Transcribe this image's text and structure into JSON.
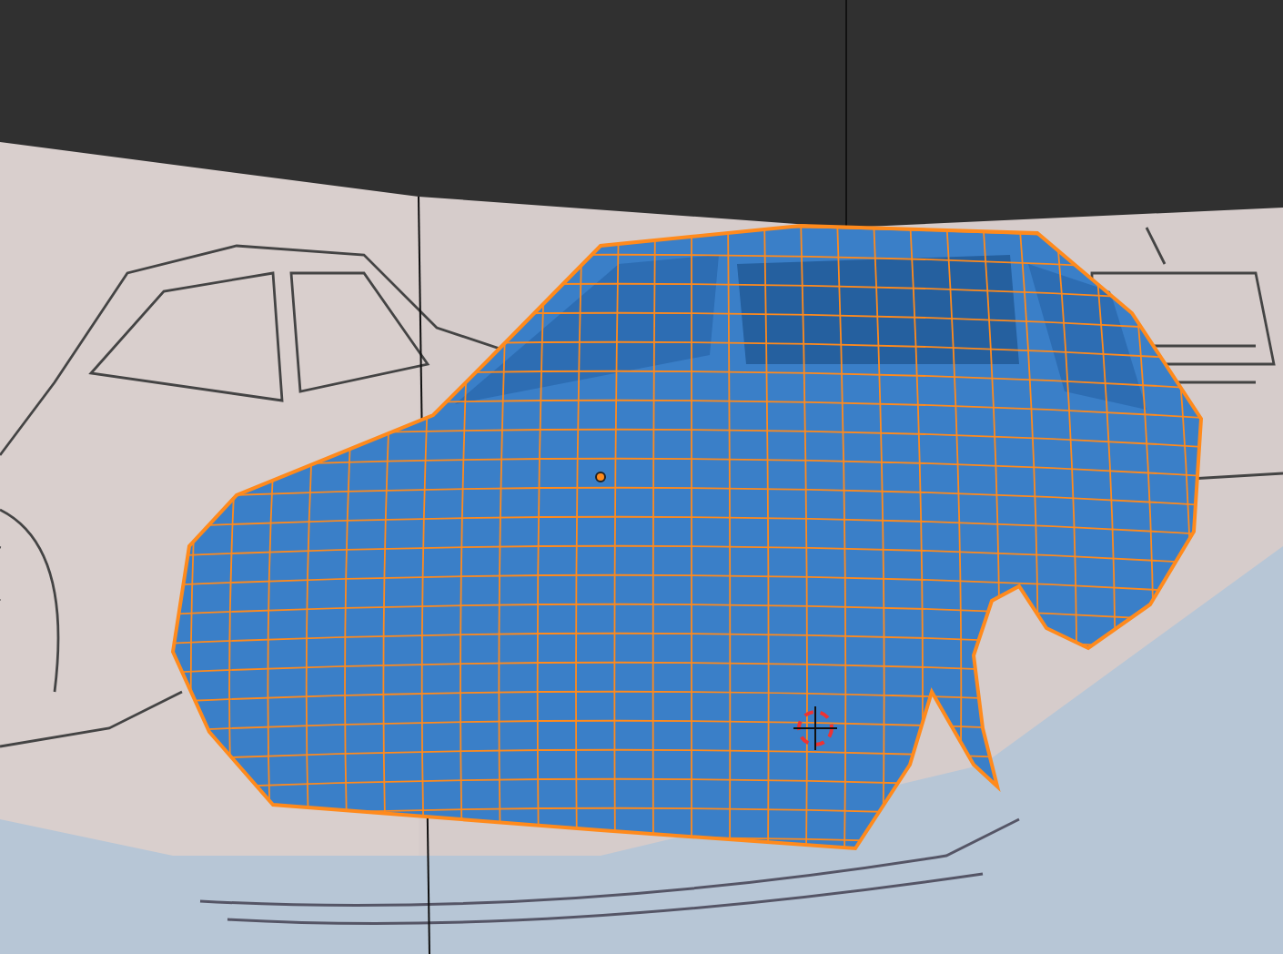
{
  "viewport": {
    "mesh": {
      "selected": true
    }
  }
}
